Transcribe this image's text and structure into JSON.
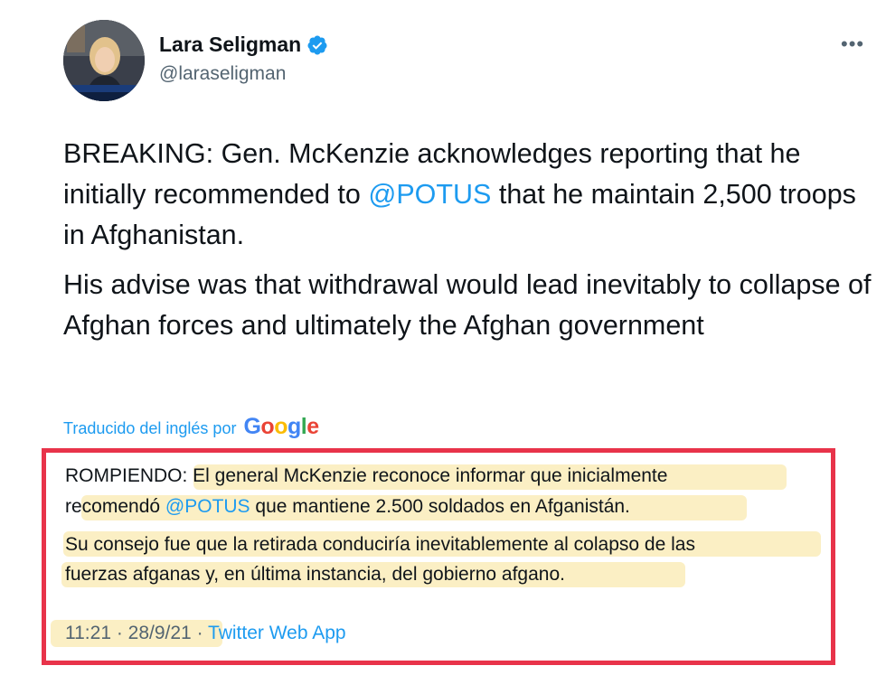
{
  "author": {
    "name": "Lara Seligman",
    "handle": "@laraseligman",
    "verified_icon": "verified-badge-icon",
    "more_icon": "ellipsis-icon",
    "more_glyph": "•••"
  },
  "tweet": {
    "p1_before": "BREAKING: Gen. McKenzie acknowledges reporting that he initially recommended to ",
    "p1_mention": "@POTUS",
    "p1_after": " that he maintain 2,500 troops in Afghanistan.",
    "p2": "His advise was that withdrawal would lead inevitably to collapse of Afghan forces and ultimately the Afghan government"
  },
  "translation": {
    "label": "Traducido del inglés por",
    "provider": "Google",
    "line1": "ROMPIENDO: El general McKenzie reconoce informar que inicialmente",
    "line2_before": "recomendó ",
    "line2_mention": "@POTUS",
    "line2_after": " que mantiene 2.500 soldados en Afganistán.",
    "line3": " Su consejo fue que la retirada conduciría inevitablemente al colapso de las",
    "line4": "fuerzas afganas y, en última instancia, del gobierno afgano."
  },
  "meta": {
    "time": "11:21",
    "sep1": " · ",
    "date": "28/9/21",
    "sep2": " · ",
    "source": "Twitter Web App"
  },
  "colors": {
    "link": "#1d9bf0",
    "highlight": "#fbefc4",
    "annotation_box": "#e8334a"
  }
}
